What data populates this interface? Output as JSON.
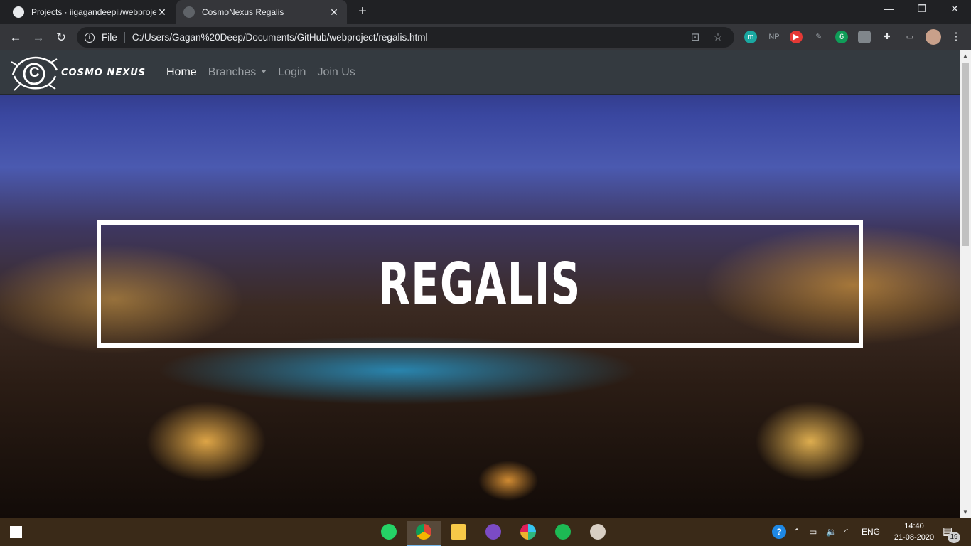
{
  "browser": {
    "tabs": [
      {
        "title": "Projects · iigagandeepii/webproject"
      },
      {
        "title": "CosmoNexus Regalis"
      }
    ],
    "new_tab_label": "+",
    "address": {
      "scheme_label": "File",
      "url": "C:/Users/Gagan%20Deep/Documents/GitHub/webproject/regalis.html"
    },
    "extensions": [
      "m",
      "NP",
      "6"
    ],
    "window_controls": {
      "minimize": "—",
      "maximize": "❐",
      "close": "✕"
    }
  },
  "site": {
    "brand": "Cosmo Nexus",
    "logo_letter": "C",
    "nav": [
      {
        "label": "Home",
        "active": true
      },
      {
        "label": "Branches",
        "dropdown": true
      },
      {
        "label": "Login"
      },
      {
        "label": "Join Us"
      }
    ],
    "hero_title": "REGALIS"
  },
  "taskbar": {
    "apps": [
      "whatsapp-icon",
      "chrome-icon",
      "file-explorer-icon",
      "github-desktop-icon",
      "slack-icon",
      "spotify-icon",
      "paint-icon"
    ],
    "tray": {
      "language": "ENG",
      "time": "14:40",
      "date": "21-08-2020",
      "notifications": "19"
    }
  },
  "colors": {
    "navbar": "#343a40",
    "nav_active": "#ffffff",
    "nav_muted": "#999ea3",
    "hero_border": "#ffffff"
  }
}
